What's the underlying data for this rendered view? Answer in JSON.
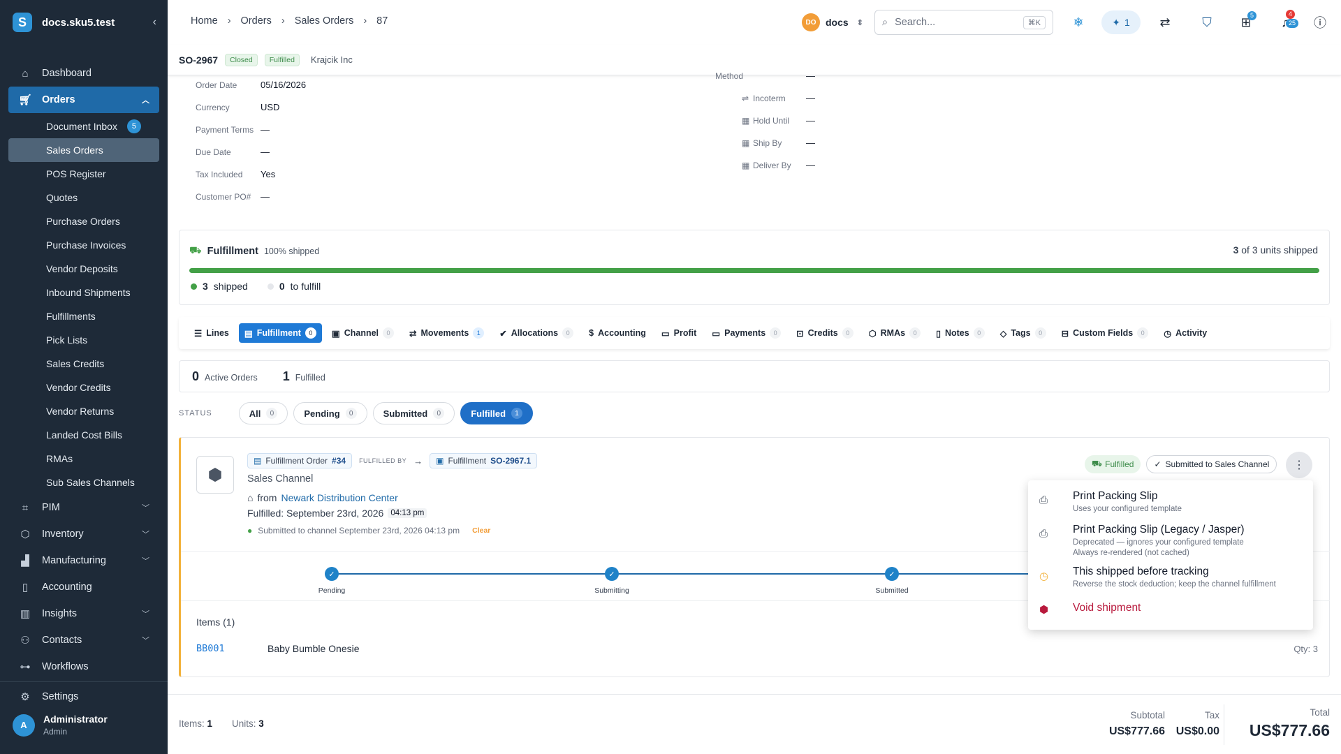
{
  "sidebar": {
    "brand": "docs.sku5.test",
    "items_top": [
      {
        "label": "Dashboard"
      }
    ],
    "orders_label": "Orders",
    "orders_sub": [
      {
        "label": "Document Inbox",
        "badge": "5"
      },
      {
        "label": "Sales Orders"
      },
      {
        "label": "POS Register"
      },
      {
        "label": "Quotes"
      },
      {
        "label": "Purchase Orders"
      },
      {
        "label": "Purchase Invoices"
      },
      {
        "label": "Vendor Deposits"
      },
      {
        "label": "Inbound Shipments"
      },
      {
        "label": "Fulfillments"
      },
      {
        "label": "Pick Lists"
      },
      {
        "label": "Sales Credits"
      },
      {
        "label": "Vendor Credits"
      },
      {
        "label": "Vendor Returns"
      },
      {
        "label": "Landed Cost Bills"
      },
      {
        "label": "RMAs"
      },
      {
        "label": "Sub Sales Channels"
      }
    ],
    "items_bottom": [
      {
        "label": "PIM"
      },
      {
        "label": "Inventory"
      },
      {
        "label": "Manufacturing"
      },
      {
        "label": "Accounting"
      },
      {
        "label": "Insights"
      },
      {
        "label": "Contacts"
      },
      {
        "label": "Workflows"
      }
    ],
    "settings": "Settings",
    "user": {
      "initial": "A",
      "name": "Administrator",
      "role": "Admin"
    }
  },
  "breadcrumb": [
    "Home",
    "Orders",
    "Sales Orders",
    "87"
  ],
  "topbar": {
    "org_initials": "DO",
    "org_name": "docs",
    "search_placeholder": "Search...",
    "search_shortcut": "⌘K",
    "ai_count": "1",
    "gift_badge": "5",
    "notif_badge_red": "4",
    "notif_badge_blue": "25"
  },
  "order": {
    "number": "SO-2967",
    "status1": "Closed",
    "status2": "Fulfilled",
    "customer": "Krajcik Inc"
  },
  "details_left": [
    {
      "label": "Order Date",
      "value": "05/16/2026"
    },
    {
      "label": "Currency",
      "value": "USD"
    },
    {
      "label": "Payment Terms",
      "value": "—"
    },
    {
      "label": "Due Date",
      "value": "—"
    },
    {
      "label": "Tax Included",
      "value": "Yes"
    },
    {
      "label": "Customer PO#",
      "value": "—"
    }
  ],
  "details_right": [
    {
      "label": "Method",
      "value": "—"
    },
    {
      "label": "Incoterm",
      "value": "—"
    },
    {
      "label": "Hold Until",
      "value": "—"
    },
    {
      "label": "Ship By",
      "value": "—"
    },
    {
      "label": "Deliver By",
      "value": "—"
    }
  ],
  "fulfillment": {
    "title": "Fulfillment",
    "subtitle": "100% shipped",
    "units_shipped": "3",
    "units_total_text": "of 3 units shipped",
    "shipped_count": "3",
    "shipped_label": "shipped",
    "to_fulfill_count": "0",
    "to_fulfill_label": "to fulfill",
    "progress": 1.0
  },
  "tabs": [
    {
      "label": "Lines"
    },
    {
      "label": "Fulfillment",
      "count": "0"
    },
    {
      "label": "Channel",
      "count": "0"
    },
    {
      "label": "Movements",
      "count": "1"
    },
    {
      "label": "Allocations",
      "count": "0"
    },
    {
      "label": "Accounting"
    },
    {
      "label": "Profit"
    },
    {
      "label": "Payments",
      "count": "0"
    },
    {
      "label": "Credits",
      "count": "0"
    },
    {
      "label": "RMAs",
      "count": "0"
    },
    {
      "label": "Notes",
      "count": "0"
    },
    {
      "label": "Tags",
      "count": "0"
    },
    {
      "label": "Custom Fields",
      "count": "0"
    },
    {
      "label": "Activity"
    }
  ],
  "summary": {
    "active_count": "0",
    "active_label": "Active Orders",
    "fulfilled_count": "1",
    "fulfilled_label": "Fulfilled"
  },
  "status_filter": {
    "label": "STATUS",
    "options": [
      {
        "label": "All",
        "count": "0"
      },
      {
        "label": "Pending",
        "count": "0"
      },
      {
        "label": "Submitted",
        "count": "0"
      },
      {
        "label": "Fulfilled",
        "count": "1"
      }
    ]
  },
  "forder": {
    "chip1_label": "Fulfillment Order",
    "chip1_num": "#34",
    "fulfilled_by": "FULFILLED BY",
    "chip2_label": "Fulfillment",
    "chip2_num": "SO-2967.1",
    "channel": "Sales Channel",
    "from": "from",
    "warehouse": "Newark Distribution Center",
    "fulfilled_text": "Fulfilled: September 23rd, 2026",
    "fulfilled_time": "04:13 pm",
    "submitted_text": "Submitted to channel September 23rd, 2026 04:13 pm",
    "clear": "Clear",
    "badge_fulfilled": "Fulfilled",
    "badge_submitted": "Submitted to Sales Channel",
    "steps": [
      "Pending",
      "Submitting",
      "Submitted"
    ],
    "items_title": "Items (1)",
    "item_sku": "BB001",
    "item_name": "Baby Bumble Onesie",
    "item_qty": "Qty: 3"
  },
  "menu": [
    {
      "title": "Print Packing Slip",
      "sub": "Uses your configured template",
      "icon": "printer-icon"
    },
    {
      "title": "Print Packing Slip (Legacy / Jasper)",
      "sub": "Deprecated — ignores your configured template",
      "sub2": "Always re-rendered (not cached)",
      "icon": "printer-icon"
    },
    {
      "title": "This shipped before tracking",
      "sub": "Reverse the stock deduction; keep the channel fulfillment",
      "icon": "clock-icon"
    },
    {
      "title": "Void shipment",
      "icon": "void-box-icon"
    }
  ],
  "footer": {
    "items_label": "Items:",
    "items_val": "1",
    "units_label": "Units:",
    "units_val": "3",
    "subtotal_label": "Subtotal",
    "subtotal_val": "US$777.66",
    "tax_label": "Tax",
    "tax_val": "US$0.00",
    "total_label": "Total",
    "total_val": "US$777.66"
  },
  "colors": {
    "accent": "#1f6aa8",
    "sidebar": "#1e2a38",
    "success": "#43a047",
    "danger": "#b8193c",
    "warning": "#f2b13a"
  }
}
